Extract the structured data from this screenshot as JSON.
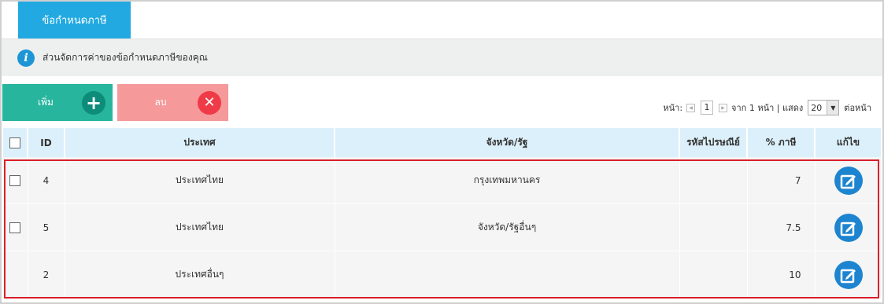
{
  "tab": {
    "label": "ข้อกำหนดภาษี"
  },
  "info": {
    "text": "ส่วนจัดการค่าของข้อกำหนดภาษีของคุณ"
  },
  "buttons": {
    "add": "เพิ่ม",
    "delete": "ลบ"
  },
  "pagination": {
    "page_label": "หน้า:",
    "current_page": "1",
    "of_text": "จาก 1 หน้า | แสดง",
    "per_page": "20",
    "per_page_suffix": "ต่อหน้า"
  },
  "table": {
    "headers": {
      "id": "ID",
      "country": "ประเทศ",
      "province": "จังหวัด/รัฐ",
      "postal": "รหัสไปรษณีย์",
      "tax": "% ภาษี",
      "edit": "แก้ไข"
    },
    "rows": [
      {
        "id": "4",
        "country": "ประเทศไทย",
        "province": "กรุงเทพมหานคร",
        "postal": "",
        "tax": "7"
      },
      {
        "id": "5",
        "country": "ประเทศไทย",
        "province": "จังหวัด/รัฐอื่นๆ",
        "postal": "",
        "tax": "7.5"
      },
      {
        "id": "2",
        "country": "ประเทศอื่นๆ",
        "province": "",
        "postal": "",
        "tax": "10"
      }
    ]
  },
  "colors": {
    "tab": "#22a9e1",
    "add": "#27b59e",
    "delete": "#f5999a",
    "header": "#dcf0fb",
    "highlight": "#d9202a",
    "edit": "#1d84cf"
  }
}
